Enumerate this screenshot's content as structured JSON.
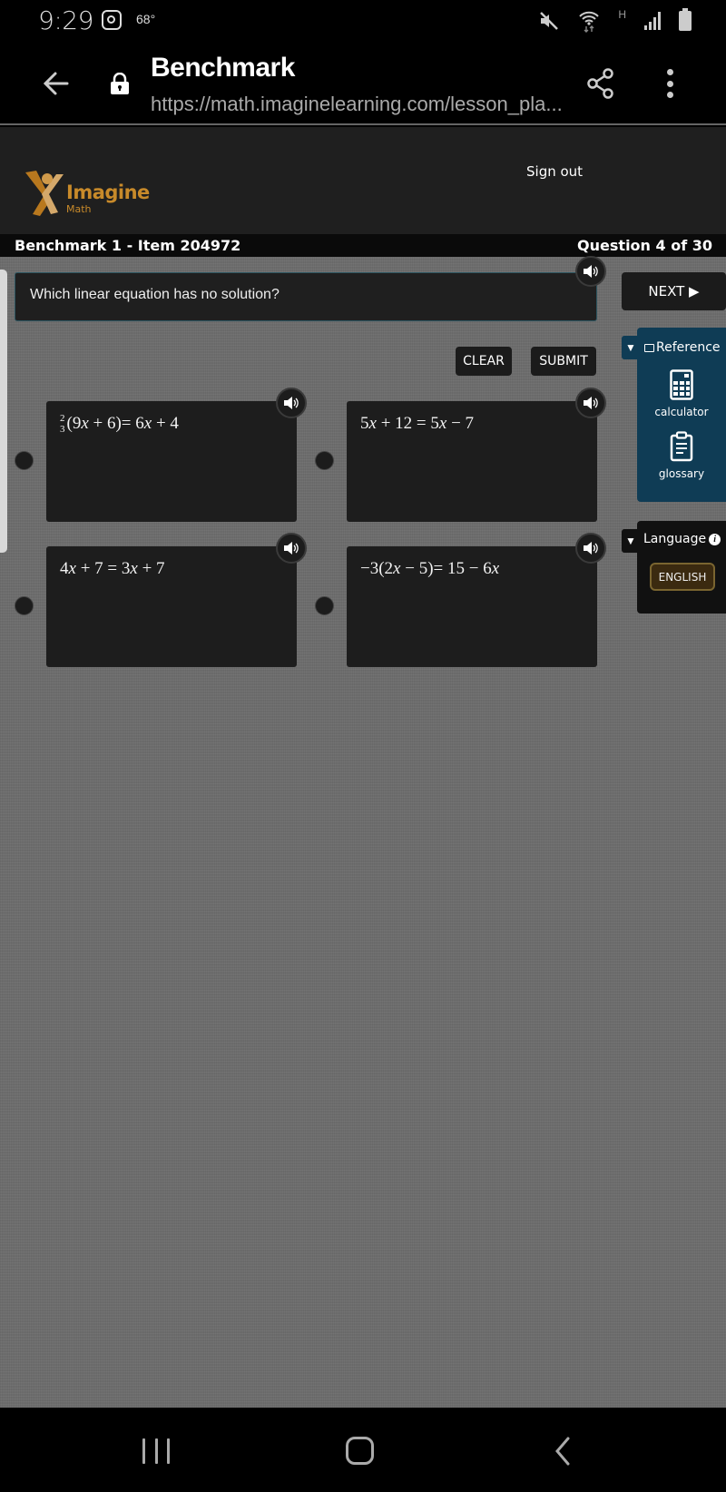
{
  "status_bar": {
    "time": "9:29",
    "temperature": "68°",
    "icons": [
      "instagram-icon",
      "mute-icon",
      "wifi-icon",
      "network-type-H",
      "signal-icon",
      "battery-icon"
    ],
    "network_type": "H"
  },
  "browser": {
    "page_title": "Benchmark",
    "url": "https://math.imaginelearning.com/lesson_pla...",
    "icons": [
      "back-arrow-icon",
      "lock-icon",
      "share-icon",
      "more-vert-icon"
    ]
  },
  "app_header": {
    "logo_name": "Imagine",
    "logo_sub": "Math",
    "sign_out": "Sign out",
    "brand_color": "#c88a2a"
  },
  "item_bar": {
    "title": "Benchmark 1 - Item 204972",
    "progress": "Question 4 of 30",
    "current_question": 4,
    "total_questions": 30
  },
  "question": {
    "text": "Which linear equation has no solution?"
  },
  "buttons": {
    "next": "NEXT ▶",
    "clear": "CLEAR",
    "submit": "SUBMIT"
  },
  "reference": {
    "toggle": "▼",
    "title": "Reference",
    "tools": [
      {
        "label": "calculator",
        "icon": "calculator-icon"
      },
      {
        "label": "glossary",
        "icon": "clipboard-icon"
      }
    ],
    "panel_color": "#0f3c55"
  },
  "language": {
    "toggle": "▼",
    "title": "Language",
    "info": "i",
    "selected": "ENGLISH"
  },
  "answers": [
    {
      "id": "A",
      "equation": "2/3(9x + 6) = 6x + 4",
      "frac_num": "2",
      "frac_den": "3",
      "rest": "(9<i>x</i> + 6)= 6<i>x</i> + 4",
      "selected": false
    },
    {
      "id": "B",
      "equation": "5x + 12 = 5x − 7",
      "rest": "5<i>x</i> + 12 = 5<i>x</i> − 7",
      "selected": false
    },
    {
      "id": "C",
      "equation": "4x + 7 = 3x + 7",
      "rest": "4<i>x</i> + 7 = 3<i>x</i> + 7",
      "selected": false
    },
    {
      "id": "D",
      "equation": "−3(2x − 5) = 15 − 6x",
      "rest": "−3(2<i>x</i> − 5)= 15 − 6<i>x</i>",
      "selected": false
    }
  ],
  "nav_bar": {
    "icons": [
      "recent-apps-icon",
      "home-icon",
      "nav-back-icon"
    ]
  }
}
